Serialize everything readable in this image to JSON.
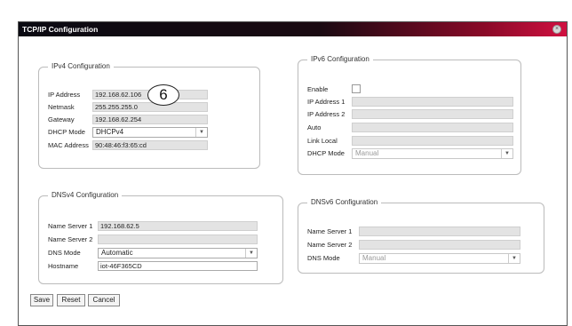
{
  "window": {
    "title": "TCP/IP Configuration",
    "close_glyph": "×"
  },
  "callout": "6",
  "ipv4": {
    "legend": "IPv4 Configuration",
    "ip_label": "IP Address",
    "ip_value": "192.168.62.106",
    "netmask_label": "Netmask",
    "netmask_value": "255.255.255.0",
    "gateway_label": "Gateway",
    "gateway_value": "192.168.62.254",
    "dhcp_label": "DHCP Mode",
    "dhcp_value": "DHCPv4",
    "mac_label": "MAC Address",
    "mac_value": "90:48:46:f3:65:cd"
  },
  "ipv6": {
    "legend": "IPv6 Configuration",
    "enable_label": "Enable",
    "ip1_label": "IP Address 1",
    "ip1_value": "",
    "ip2_label": "IP Address 2",
    "ip2_value": "",
    "auto_label": "Auto",
    "auto_value": "",
    "linklocal_label": "Link Local",
    "linklocal_value": "",
    "dhcp_label": "DHCP Mode",
    "dhcp_value": "Manual"
  },
  "dnsv4": {
    "legend": "DNSv4 Configuration",
    "ns1_label": "Name Server 1",
    "ns1_value": "192.168.62.5",
    "ns2_label": "Name Server 2",
    "ns2_value": "",
    "mode_label": "DNS Mode",
    "mode_value": "Automatic",
    "hostname_label": "Hostname",
    "hostname_value": "iot-46F365CD"
  },
  "dnsv6": {
    "legend": "DNSv6 Configuration",
    "ns1_label": "Name Server 1",
    "ns1_value": "",
    "ns2_label": "Name Server 2",
    "ns2_value": "",
    "mode_label": "DNS Mode",
    "mode_value": "Manual"
  },
  "buttons": {
    "save": "Save",
    "reset": "Reset",
    "cancel": "Cancel"
  },
  "colors": {
    "titlebar_start": "#0a0a12",
    "titlebar_end": "#d01040",
    "readonly_field": "#e3e3e3"
  },
  "icons": {
    "close": "close-icon",
    "dropdown": "chevron-down-icon"
  }
}
